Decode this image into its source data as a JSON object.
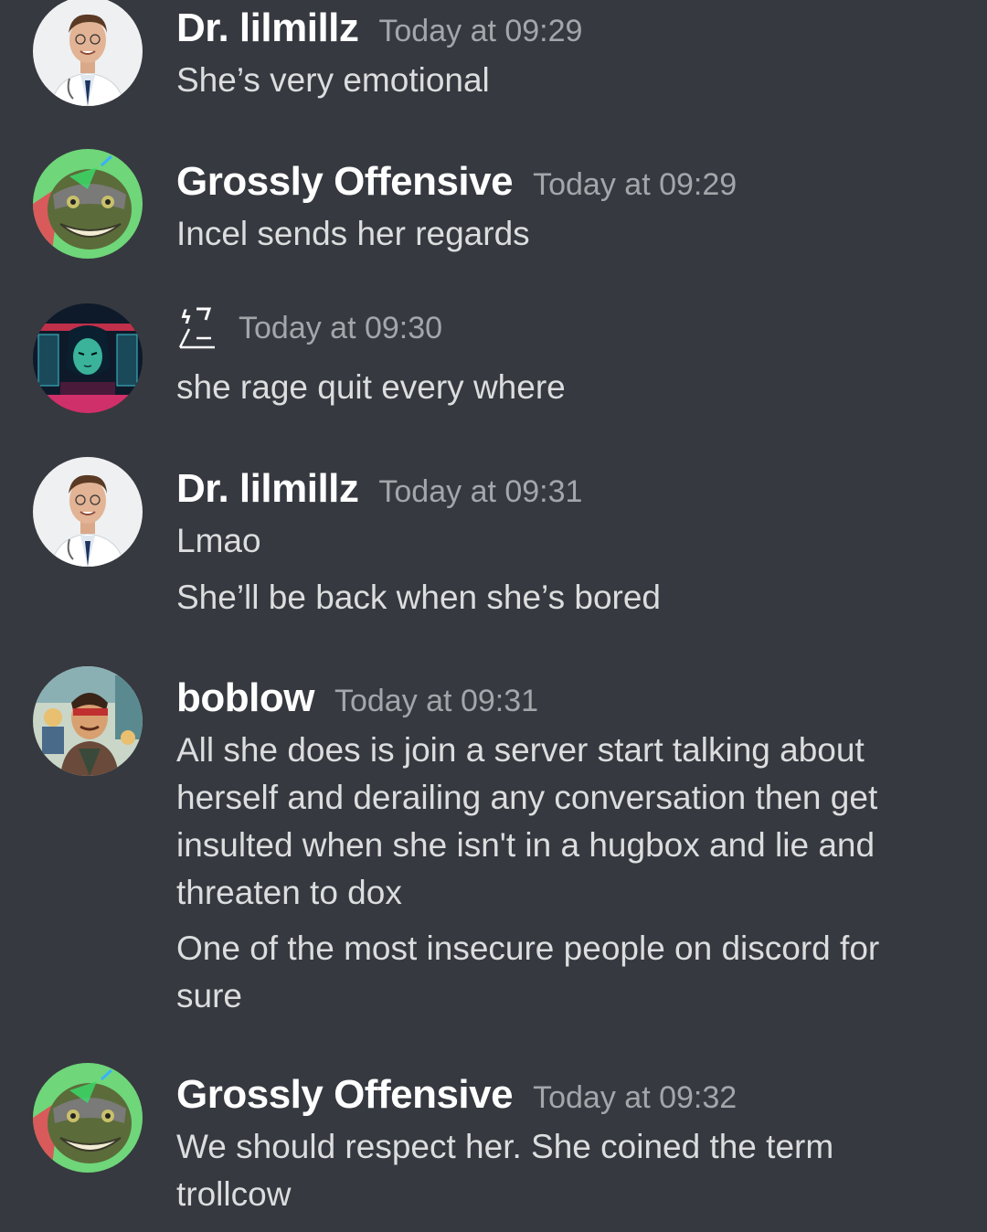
{
  "messages": [
    {
      "username": "Dr. lilmillz",
      "timestamp": "Today at 09:29",
      "avatar": "doctor-avatar",
      "lines": [
        "She’s very emotional"
      ]
    },
    {
      "username": "Grossly Offensive",
      "timestamp": "Today at 09:29",
      "avatar": "turtle-avatar",
      "lines": [
        "Incel sends her regards"
      ]
    },
    {
      "username": "ϟ7\n/–",
      "timestamp": "Today at 09:30",
      "avatar": "cyber-avatar",
      "lines": [
        "she rage quit every where"
      ]
    },
    {
      "username": "Dr. lilmillz",
      "timestamp": "Today at 09:31",
      "avatar": "doctor-avatar",
      "lines": [
        "Lmao",
        "She’ll be back when she’s bored"
      ]
    },
    {
      "username": "boblow",
      "timestamp": "Today at 09:31",
      "avatar": "anime-avatar",
      "lines": [
        "All she does is join a server start talking about herself and derailing any conversation then get insulted when she isn't in a hugbox and lie and threaten to dox",
        "One of the most insecure people on discord for sure"
      ]
    },
    {
      "username": "Grossly Offensive",
      "timestamp": "Today at 09:32",
      "avatar": "turtle-avatar",
      "lines": [
        "We should respect her. She coined the term trollcow"
      ]
    }
  ],
  "colors": {
    "background": "#36393f",
    "username": "#ffffff",
    "timestamp": "#a3a6aa",
    "text": "#dcddde"
  }
}
